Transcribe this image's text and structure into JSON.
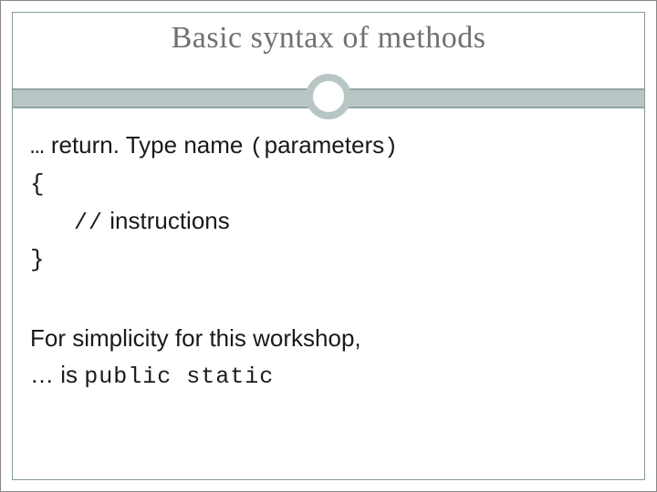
{
  "title": "Basic syntax of methods",
  "syntax": {
    "ellipsis": "…",
    "signature_1": " return. Type  name ",
    "lparen": "(",
    "params": "parameters",
    "rparen": ")",
    "brace_open": "{",
    "comment_slashes": "//",
    "comment_text": "  instructions",
    "brace_close": "}"
  },
  "footer": {
    "line1": "For simplicity for this workshop,",
    "line2_prefix": "… is ",
    "line2_code": "public static"
  }
}
